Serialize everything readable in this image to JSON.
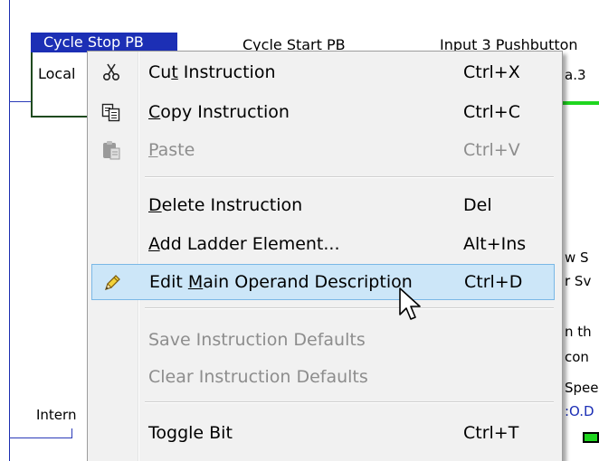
{
  "ladder": {
    "tag_title": "Cycle Stop PB",
    "tag_local": "Local",
    "label_cycle_start": "Cycle Start PB",
    "label_input3": "Input 3 Pushbutton",
    "right_fragments": [
      "a.3",
      "w S",
      "r Sv",
      "n th",
      "con",
      "Spee",
      ":O.D"
    ],
    "intern_label": "Intern"
  },
  "context_menu": {
    "items": [
      {
        "pre": "Cu",
        "ul": "t",
        "post": " Instruction",
        "shortcut": "Ctrl+X",
        "icon": "scissors-icon",
        "enabled": true
      },
      {
        "pre": "",
        "ul": "C",
        "post": "opy Instruction",
        "shortcut": "Ctrl+C",
        "icon": "copy-icon",
        "enabled": true
      },
      {
        "pre": "",
        "ul": "P",
        "post": "aste",
        "shortcut": "Ctrl+V",
        "icon": "paste-icon",
        "enabled": false
      },
      {
        "pre": "",
        "ul": "D",
        "post": "elete Instruction",
        "shortcut": "Del",
        "icon": "",
        "enabled": true
      },
      {
        "pre": "",
        "ul": "A",
        "post": "dd Ladder Element...",
        "shortcut": "Alt+Ins",
        "icon": "",
        "enabled": true
      },
      {
        "pre": "Edit ",
        "ul": "M",
        "post": "ain Operand Description",
        "shortcut": "Ctrl+D",
        "icon": "pencil-icon",
        "enabled": true,
        "highlighted": true
      },
      {
        "pre": "",
        "ul": "",
        "post": "Save Instruction Defaults",
        "shortcut": "",
        "icon": "",
        "enabled": false
      },
      {
        "pre": "",
        "ul": "",
        "post": "Clear Instruction Defaults",
        "shortcut": "",
        "icon": "",
        "enabled": false
      },
      {
        "pre": "",
        "ul": "",
        "post": "Toggle Bit",
        "shortcut": "Ctrl+T",
        "icon": "",
        "enabled": true
      }
    ]
  },
  "colors": {
    "menu_background": "#f1f1f1",
    "highlight_background": "#cce6f8",
    "highlight_border": "#7ab8e6",
    "disabled_text": "#8d8d8d",
    "tag_title_background": "#1c2fb5",
    "rung_green": "#1fd61f"
  }
}
